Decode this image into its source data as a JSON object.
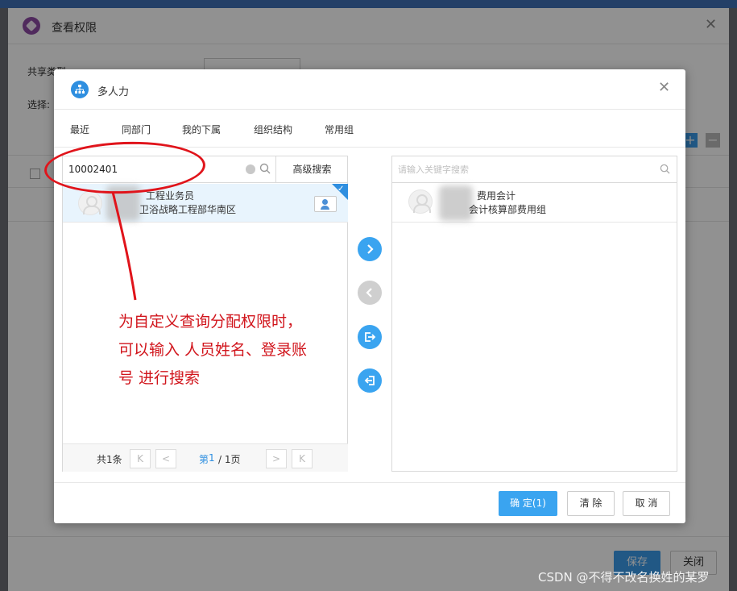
{
  "outer_dialog": {
    "title": "查看权限",
    "share_type_label": "共享类型",
    "select_label": "选择:",
    "save_label": "保存",
    "close_label": "关闭"
  },
  "modal": {
    "title": "多人力",
    "tabs": [
      "最近",
      "同部门",
      "我的下属",
      "组织结构",
      "常用组"
    ],
    "left": {
      "search_value": "10002401",
      "advanced_search_label": "高级搜索",
      "result": {
        "line1": "工程业务员",
        "line2": "卫浴战略工程部华南区"
      },
      "pager": {
        "total": "共1条",
        "first": "K",
        "prev": "<",
        "page_prefix": "第",
        "page_current": "1",
        "page_suffix": "/ 1页",
        "next": ">",
        "last": "K"
      }
    },
    "right": {
      "search_placeholder": "请输入关键字搜索",
      "selected": {
        "line1": "费用会计",
        "line2": "会计核算部费用组"
      }
    },
    "buttons": {
      "confirm": "确 定(1)",
      "clear": "清 除",
      "cancel": "取 消"
    }
  },
  "annotation": {
    "lines": [
      "为自定义查询分配权限时，",
      "可以输入 人员姓名、登录账",
      "号 进行搜索"
    ],
    "color": "#d1151c"
  },
  "watermark": "CSDN @不得不改名换姓的某罗",
  "colors": {
    "accent": "#3aa4f0",
    "selected_row": "#e8f4fd"
  }
}
